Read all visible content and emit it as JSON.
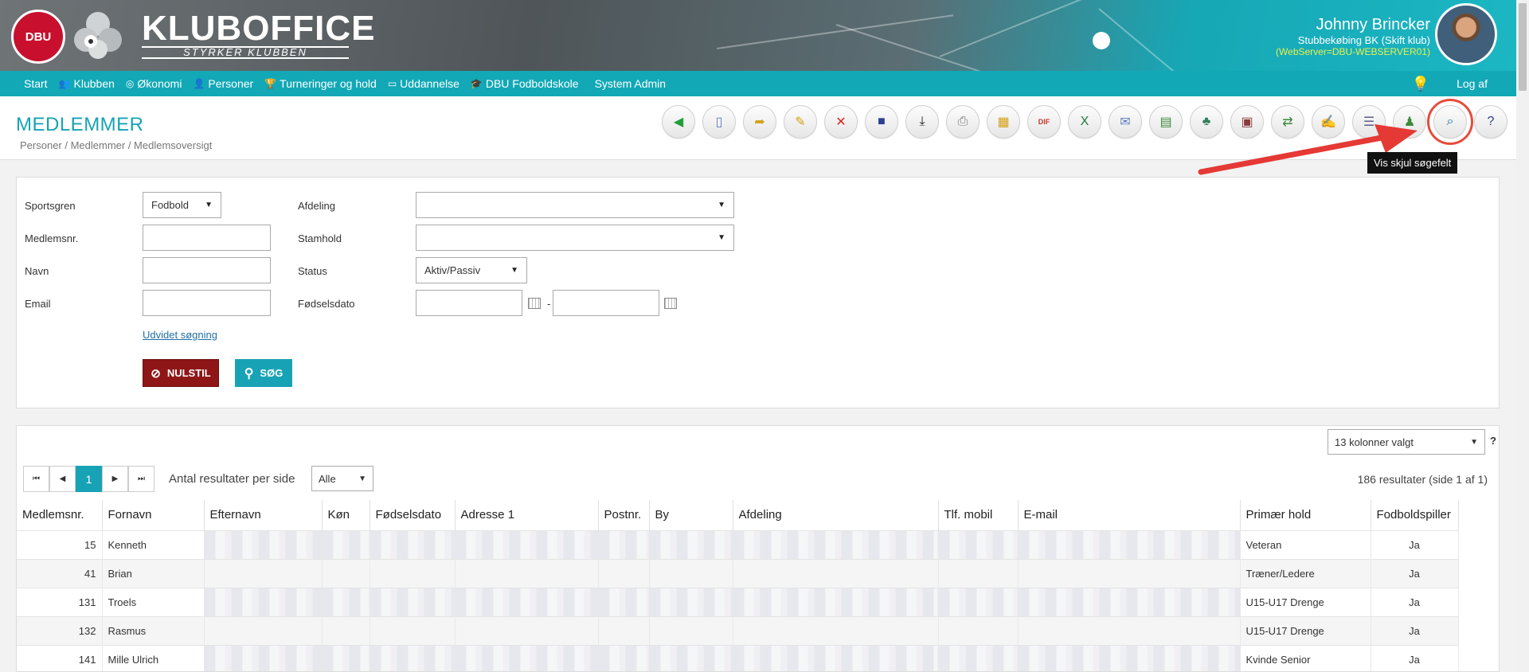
{
  "header": {
    "brand_title": "KLUBOFFICE",
    "brand_subtitle": "STYRKER KLUBBEN",
    "dbu_logo_text": "DBU",
    "user_name": "Johnny Brincker",
    "user_club": "Stubbekøbing BK (Skift klub)",
    "server": "(WebServer=DBU-WEBSERVER01)"
  },
  "nav": {
    "items": [
      {
        "label": "Start",
        "icon": ""
      },
      {
        "label": "Klubben",
        "icon": "people-icon"
      },
      {
        "label": "Økonomi",
        "icon": "coin-icon"
      },
      {
        "label": "Personer",
        "icon": "person-icon"
      },
      {
        "label": "Turneringer og hold",
        "icon": "trophy-icon"
      },
      {
        "label": "Uddannelse",
        "icon": "board-icon"
      },
      {
        "label": "DBU Fodboldskole",
        "icon": "graduation-icon"
      },
      {
        "label": "System Admin",
        "icon": ""
      }
    ],
    "logout": "Log af"
  },
  "page": {
    "title": "MEDLEMMER",
    "breadcrumb": "Personer / Medlemmer / Medlemsoversigt"
  },
  "toolbar": {
    "tooltip": "Vis skjul søgefelt",
    "buttons": [
      {
        "name": "back-icon",
        "glyph": "◀",
        "color": "#1f9e3a"
      },
      {
        "name": "new-document-icon",
        "glyph": "▯",
        "color": "#5b7fbf"
      },
      {
        "name": "open-folder-icon",
        "glyph": "➦",
        "color": "#d4a017"
      },
      {
        "name": "edit-folder-icon",
        "glyph": "✎",
        "color": "#d4a017"
      },
      {
        "name": "delete-icon",
        "glyph": "✕",
        "color": "#d9281e"
      },
      {
        "name": "save-icon",
        "glyph": "■",
        "color": "#2a3f8f"
      },
      {
        "name": "download-icon",
        "glyph": "⤓",
        "color": "#222222"
      },
      {
        "name": "print-icon",
        "glyph": "⎙",
        "color": "#777777"
      },
      {
        "name": "table-icon",
        "glyph": "▦",
        "color": "#d4a017"
      },
      {
        "name": "dif-icon",
        "glyph": "DIF",
        "color": "#c0392b"
      },
      {
        "name": "excel-icon",
        "glyph": "X",
        "color": "#1e7a3a"
      },
      {
        "name": "email-icon",
        "glyph": "✉",
        "color": "#5b7fbf"
      },
      {
        "name": "report-icon",
        "glyph": "▤",
        "color": "#3a8a3a"
      },
      {
        "name": "group-icon",
        "glyph": "♣",
        "color": "#2f7d5b"
      },
      {
        "name": "id-card-icon",
        "glyph": "▣",
        "color": "#8a3a3a"
      },
      {
        "name": "members-transfer-icon",
        "glyph": "⇄",
        "color": "#3a8a3a"
      },
      {
        "name": "members-edit-icon",
        "glyph": "✍",
        "color": "#5b5b8a"
      },
      {
        "name": "members-list-icon",
        "glyph": "☰",
        "color": "#5b5b8a"
      },
      {
        "name": "member-badge-icon",
        "glyph": "♟",
        "color": "#3a8a3a"
      },
      {
        "name": "search-toggle-icon",
        "glyph": "⌕",
        "color": "#1f6fa8"
      },
      {
        "name": "help-icon",
        "glyph": "?",
        "color": "#2a3f8f"
      }
    ]
  },
  "search": {
    "sportsgren_label": "Sportsgren",
    "sportsgren_value": "Fodbold",
    "medlemsnr_label": "Medlemsnr.",
    "medlemsnr_value": "",
    "navn_label": "Navn",
    "navn_value": "",
    "email_label": "Email",
    "email_value": "",
    "afdeling_label": "Afdeling",
    "afdeling_value": "",
    "stamhold_label": "Stamhold",
    "stamhold_value": "",
    "status_label": "Status",
    "status_value": "Aktiv/Passiv",
    "fodselsdato_label": "Fødselsdato",
    "date_from": "",
    "date_to": "",
    "date_separator": "-",
    "advanced_link": "Udvidet søgning",
    "reset_button": "NULSTIL",
    "search_button": "SØG"
  },
  "results": {
    "columns_selected": "13 kolonner valgt",
    "help": "?",
    "current_page": "1",
    "per_page_label": "Antal resultater per side",
    "per_page_value": "Alle",
    "count_text": "186 resultater (side 1 af 1)",
    "headers": [
      "Medlemsnr.",
      "Fornavn",
      "Efternavn",
      "Køn",
      "Fødselsdato",
      "Adresse 1",
      "Postnr.",
      "By",
      "Afdeling",
      "Tlf. mobil",
      "E-mail",
      "Primær hold",
      "Fodboldspiller"
    ],
    "rows": [
      {
        "nr": "15",
        "fornavn": "Kenneth",
        "hold": "Veteran",
        "spiller": "Ja"
      },
      {
        "nr": "41",
        "fornavn": "Brian",
        "hold": "Træner/Ledere",
        "spiller": "Ja"
      },
      {
        "nr": "131",
        "fornavn": "Troels",
        "hold": "U15-U17 Drenge",
        "spiller": "Ja"
      },
      {
        "nr": "132",
        "fornavn": "Rasmus",
        "hold": "U15-U17 Drenge",
        "spiller": "Ja"
      },
      {
        "nr": "141",
        "fornavn": "Mille Ulrich",
        "hold": "Kvinde Senior",
        "spiller": "Ja"
      }
    ]
  },
  "colors": {
    "accent": "#17a3b5",
    "reset": "#8e1616",
    "highlight": "#e74c3c",
    "server_text": "#e8f04a"
  }
}
